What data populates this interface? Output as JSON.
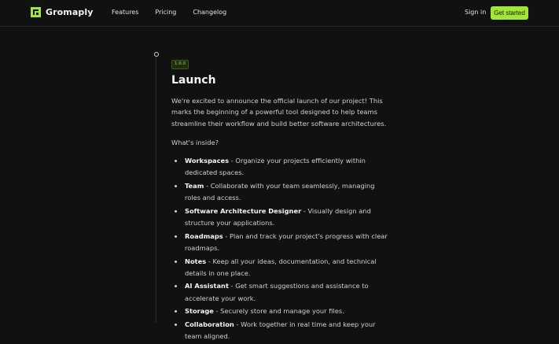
{
  "header": {
    "brand": "Gromaply",
    "nav": [
      {
        "label": "Features"
      },
      {
        "label": "Pricing"
      },
      {
        "label": "Changelog"
      }
    ],
    "sign_in": "Sign in",
    "cta": "Get started"
  },
  "release": {
    "version": "1.0.0",
    "title": "Launch",
    "intro": "We're excited to announce the official launch of our project! This marks the beginning of a powerful tool designed to help teams streamline their workflow and build better software architectures.",
    "subheading": "What's inside?",
    "features": [
      {
        "name": "Workspaces",
        "desc": " - Organize your projects efficiently within dedicated spaces."
      },
      {
        "name": "Team",
        "desc": " - Collaborate with your team seamlessly, managing roles and access."
      },
      {
        "name": "Software Architecture Designer",
        "desc": " - Visually design and structure your applications."
      },
      {
        "name": "Roadmaps",
        "desc": " - Plan and track your project's progress with clear roadmaps."
      },
      {
        "name": "Notes",
        "desc": " - Keep all your ideas, documentation, and technical details in one place."
      },
      {
        "name": "AI Assistant",
        "desc": " - Get smart suggestions and assistance to accelerate your work."
      },
      {
        "name": "Storage",
        "desc": " - Securely store and manage your files."
      },
      {
        "name": "Collaboration",
        "desc": " - Work together in real time and keep your team aligned."
      }
    ]
  },
  "colors": {
    "background": "#111111",
    "accent": "#a3e635"
  }
}
